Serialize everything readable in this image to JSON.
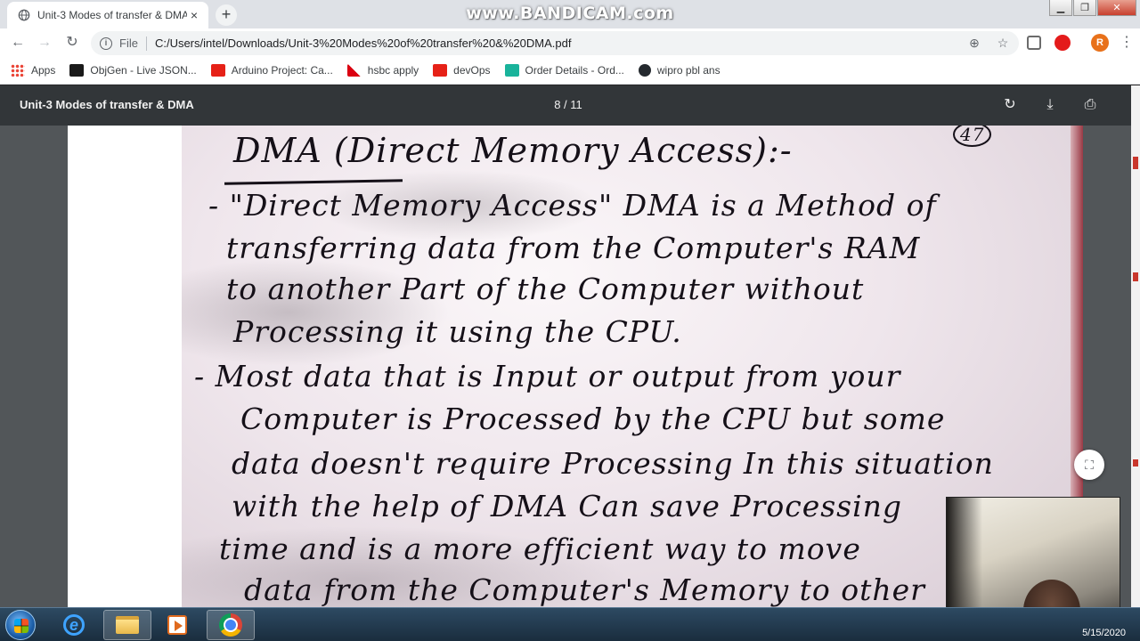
{
  "browser": {
    "tab": {
      "title": "Unit-3 Modes of transfer & DMA",
      "close": "×"
    },
    "new_tab": "+",
    "watermark": "www.BANDICAM.com",
    "omnibox": {
      "info": "i",
      "scheme": "File",
      "url": "C:/Users/intel/Downloads/Unit-3%20Modes%20of%20transfer%20&%20DMA.pdf"
    },
    "profile_initial": "R",
    "bookmarks": [
      {
        "label": "Apps",
        "icon": "apps-grid-icon",
        "color": "#4285f4"
      },
      {
        "label": "ObjGen - Live JSON...",
        "icon": "objgen-icon",
        "color": "#1a1a1a"
      },
      {
        "label": "Arduino Project: Ca...",
        "icon": "youtube-icon",
        "color": "#e62117"
      },
      {
        "label": "hsbc apply",
        "icon": "hsbc-icon",
        "color": "#db0011"
      },
      {
        "label": "devOps",
        "icon": "youtube-icon",
        "color": "#e62117"
      },
      {
        "label": "Order Details - Ord...",
        "icon": "order-icon",
        "color": "#19b39b"
      },
      {
        "label": "wipro pbl ans",
        "icon": "github-icon",
        "color": "#24292e"
      }
    ]
  },
  "pdf": {
    "title": "Unit-3 Modes of transfer & DMA",
    "page_indicator": "8 / 11",
    "page_number_mark": "47",
    "handwriting": [
      "DMA (Direct Memory Access):-",
      "- \"Direct Memory Access\" DMA is a Method of",
      "transferring data from the Computer's RAM",
      "to another Part of the Computer without",
      "Processing it using the CPU.",
      "- Most data that is Input or output from your",
      "Computer is Processed by the CPU but some",
      "data doesn't require Processing In this situation",
      "with the help of DMA Can save Processing",
      "time and is a more efficient way to move",
      "data from the Computer's Memory to other"
    ]
  },
  "taskbar": {
    "clock_date": "5/15/2020"
  },
  "colors": {
    "pdf_toolbar": "#323639",
    "viewer_bg": "#525659",
    "profile": "#e8711a",
    "taskbar": "#1a2d3e"
  }
}
